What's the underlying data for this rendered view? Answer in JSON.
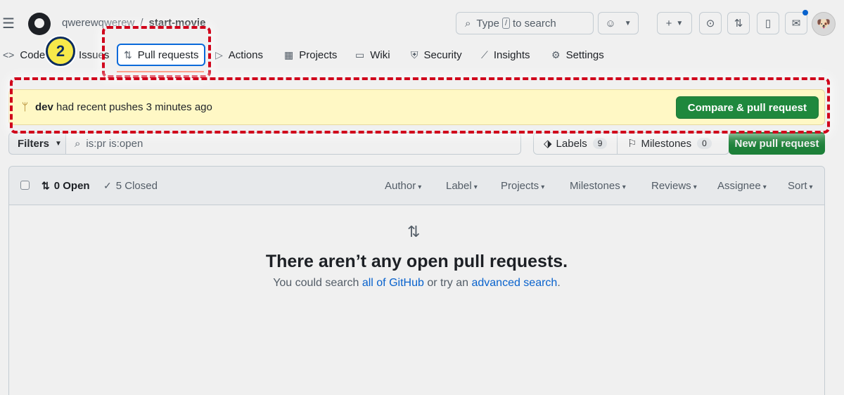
{
  "header": {
    "owner": "qwerewqwerew",
    "separator": "/",
    "repo": "start-movie",
    "search_text_before": "Type",
    "search_key": "/",
    "search_text_after": "to search"
  },
  "tabs": [
    {
      "label": "Code"
    },
    {
      "label": "Issues"
    },
    {
      "label": "Pull requests"
    },
    {
      "label": "Actions"
    },
    {
      "label": "Projects"
    },
    {
      "label": "Wiki"
    },
    {
      "label": "Security"
    },
    {
      "label": "Insights"
    },
    {
      "label": "Settings"
    }
  ],
  "step_badge": "2",
  "banner": {
    "branch": "dev",
    "message": "had recent pushes 3 minutes ago",
    "button": "Compare & pull request"
  },
  "filter": {
    "filters_label": "Filters",
    "query": "is:pr is:open",
    "labels_label": "Labels",
    "labels_count": "9",
    "milestones_label": "Milestones",
    "milestones_count": "0",
    "new_pr_label": "New pull request"
  },
  "list": {
    "open": "0 Open",
    "closed": "5 Closed",
    "sorts": [
      "Author",
      "Label",
      "Projects",
      "Milestones",
      "Reviews",
      "Assignee",
      "Sort"
    ]
  },
  "blank": {
    "title": "There aren’t any open pull requests.",
    "sub_before": "You could search",
    "link1": "all of GitHub",
    "sub_middle": "or try an",
    "link2": "advanced search",
    "sub_after": "."
  },
  "colors": {
    "accent": "#0969da",
    "primary_button": "#1f883d",
    "banner_bg": "#fff8c5",
    "highlight": "#d0021b",
    "badge_fill": "#f7e94a"
  }
}
